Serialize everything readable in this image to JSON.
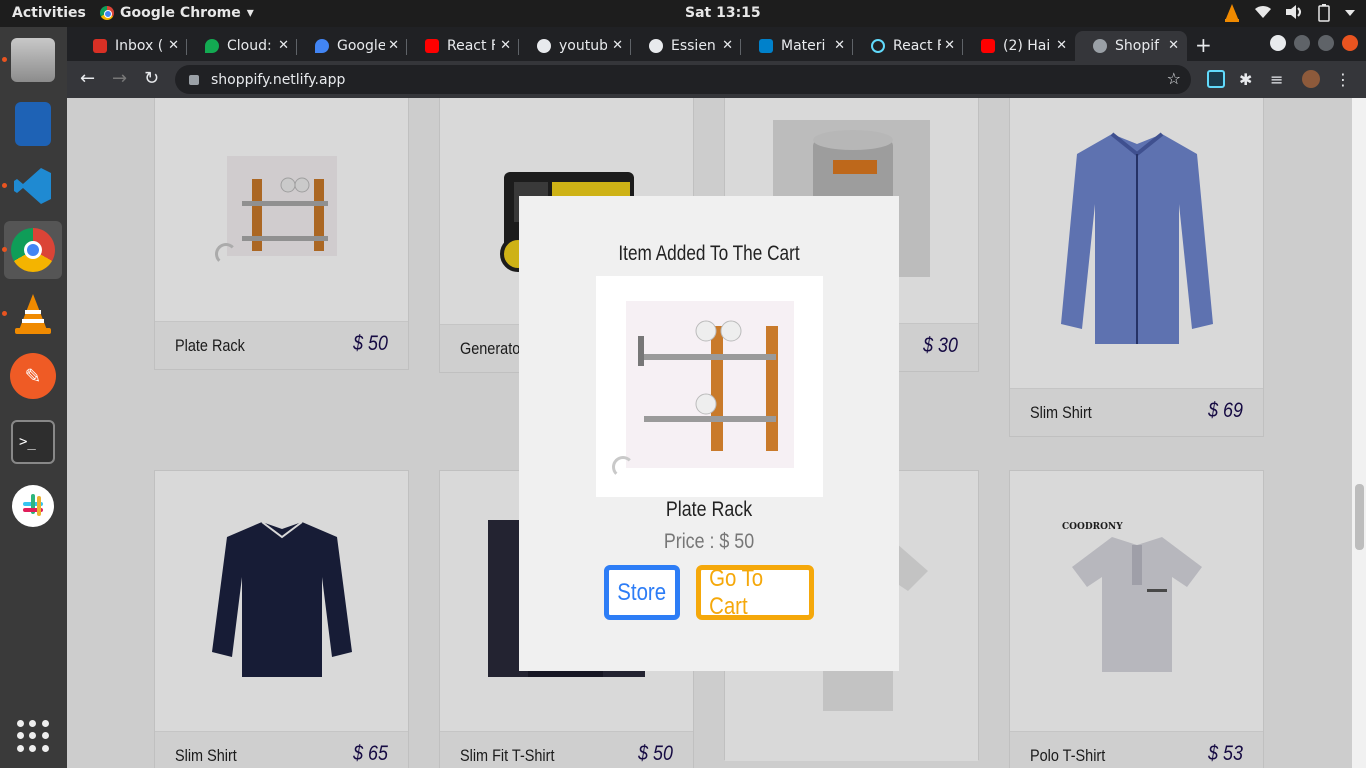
{
  "system_bar": {
    "activities": "Activities",
    "app_name": "Google Chrome",
    "clock": "Sat 13:15"
  },
  "dock": {
    "apps": [
      "file-manager",
      "writer",
      "vscode",
      "chrome",
      "vlc",
      "postman",
      "terminal",
      "slack"
    ]
  },
  "browser": {
    "tabs": [
      {
        "title": "Inbox (",
        "icon": "gmail-icon",
        "color": "#d93025"
      },
      {
        "title": "Cloud:",
        "icon": "mongodb-leaf-icon",
        "color": "#13aa52"
      },
      {
        "title": "Google",
        "icon": "google-maps-icon",
        "color": "#4285f4"
      },
      {
        "title": "React F",
        "icon": "youtube-icon",
        "color": "#ff0000"
      },
      {
        "title": "youtub",
        "icon": "github-icon",
        "color": "#e8eaed"
      },
      {
        "title": "Essien",
        "icon": "github-icon",
        "color": "#e8eaed"
      },
      {
        "title": "Materi",
        "icon": "material-ui-icon",
        "color": "#0081cb"
      },
      {
        "title": "React F",
        "icon": "react-icon",
        "color": "#61dafb"
      },
      {
        "title": "(2) Hai",
        "icon": "youtube-icon",
        "color": "#ff0000"
      },
      {
        "title": "Shopif",
        "icon": "globe-icon",
        "color": "#e8eaed",
        "active": true
      }
    ],
    "url": "shoppify.netlify.app"
  },
  "products": [
    {
      "name": "Plate Rack",
      "price": "$ 50"
    },
    {
      "name": "Generator",
      "price": ""
    },
    {
      "name": "",
      "price": "$ 30"
    },
    {
      "name": "Slim Shirt",
      "price": "$ 69"
    },
    {
      "name": "Slim Shirt",
      "price": "$ 65"
    },
    {
      "name": "Slim Fit T-Shirt",
      "price": "$ 50"
    },
    {
      "name": "",
      "price": ""
    },
    {
      "name": "Polo T-Shirt",
      "price": "$ 53"
    }
  ],
  "modal": {
    "title": "Item Added To The Cart",
    "product_name": "Plate Rack",
    "price": "Price : $ 50",
    "store_label": "Store",
    "cart_label": "Go To Cart",
    "store_color": "#2d7df6",
    "cart_color": "#f5a80a"
  },
  "brand_label": "COODRONY"
}
